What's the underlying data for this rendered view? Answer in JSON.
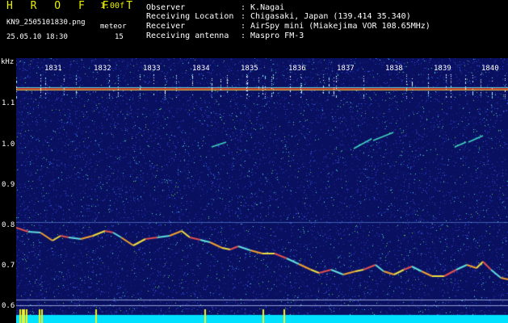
{
  "header": {
    "brand": "H R O F F T",
    "version": "1.00f",
    "filename": "KN9_2505101830.png",
    "meteor_label": "meteor",
    "meteor_count": "15",
    "datetime": "25.05.10 18:30",
    "fields": [
      {
        "label": "Observer",
        "value": ": K.Nagai"
      },
      {
        "label": "Receiving Location",
        "value": ": Chigasaki, Japan (139.414 35.340)"
      },
      {
        "label": "Receiver",
        "value": ": AirSpy mini (Miakejima VOR 108.65MHz)"
      },
      {
        "label": "Receiving antenna",
        "value": ": Maspro FM-3"
      }
    ]
  },
  "spectrogram": {
    "y_unit": "kHz",
    "y_ticks": [
      "1.1",
      "1.0",
      "0.9",
      "0.8",
      "0.7",
      "0.6"
    ],
    "time_ticks": [
      "1831",
      "1832",
      "1833",
      "1834",
      "1835",
      "1836",
      "1837",
      "1838",
      "1839",
      "1840"
    ],
    "colors": {
      "background": "#000000",
      "label": "#e8f000",
      "noise": "#1a2a9a",
      "carrier": "#d04030",
      "baseline": "#00e0ff"
    }
  }
}
